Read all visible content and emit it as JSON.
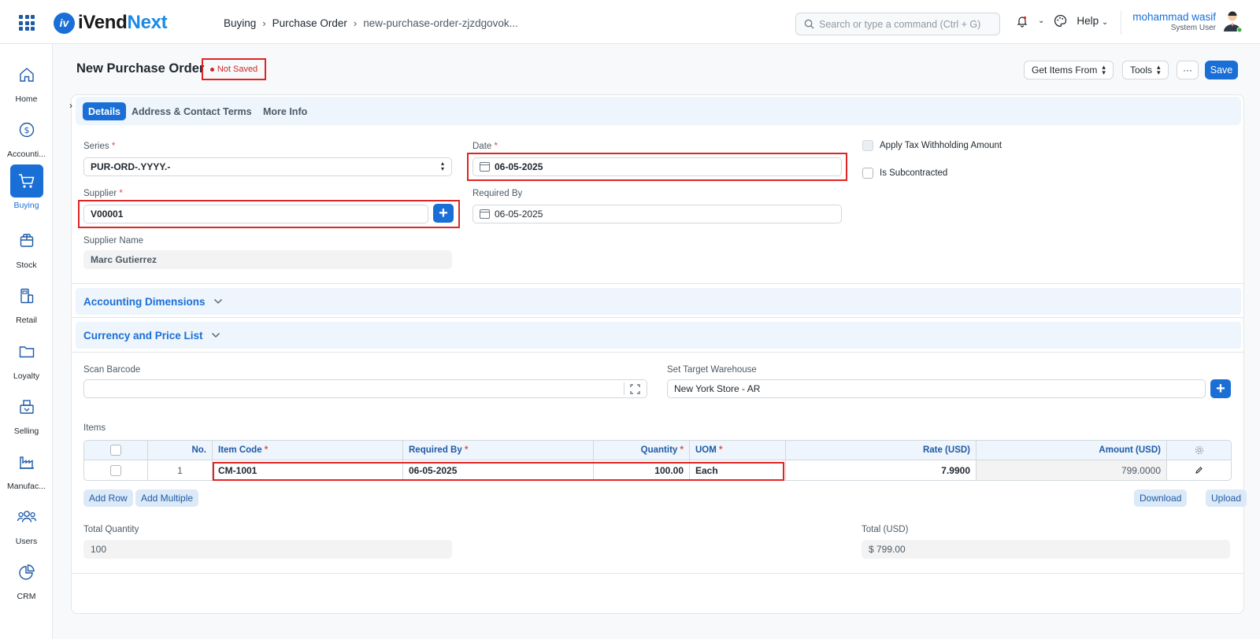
{
  "app": {
    "logo_prefix": "iVend",
    "logo_suffix": "Next"
  },
  "breadcrumb": [
    "Buying",
    "Purchase Order",
    "new-purchase-order-zjzdgovok..."
  ],
  "search": {
    "placeholder": "Search or type a command (Ctrl + G)"
  },
  "help_label": "Help",
  "user": {
    "name": "mohammad wasif",
    "role": "System User"
  },
  "sidebar": {
    "items": [
      {
        "label": "Home",
        "icon": "home-icon"
      },
      {
        "label": "Accounti...",
        "icon": "dollar-icon"
      },
      {
        "label": "Buying",
        "icon": "cart-icon",
        "active": true
      },
      {
        "label": "Stock",
        "icon": "box-icon"
      },
      {
        "label": "Retail",
        "icon": "pos-icon"
      },
      {
        "label": "Loyalty",
        "icon": "folder-icon"
      },
      {
        "label": "Selling",
        "icon": "selling-icon"
      },
      {
        "label": "Manufac...",
        "icon": "factory-icon"
      },
      {
        "label": "Users",
        "icon": "users-icon"
      },
      {
        "label": "CRM",
        "icon": "pie-chart-icon"
      }
    ]
  },
  "page": {
    "title": "New Purchase Order",
    "status": "Not Saved",
    "get_items_label": "Get Items From",
    "tools_label": "Tools",
    "more_label": "···",
    "save_label": "Save"
  },
  "tabs": [
    "Details",
    "Address & Contact",
    "Terms",
    "More Info"
  ],
  "form": {
    "series_label": "Series",
    "series_value": "PUR-ORD-.YYYY.-",
    "date_label": "Date",
    "date_value": "06-05-2025",
    "supplier_label": "Supplier",
    "supplier_value": "V00001",
    "required_by_label": "Required By",
    "required_by_value": "06-05-2025",
    "supplier_name_label": "Supplier Name",
    "supplier_name_value": "Marc Gutierrez",
    "apply_tax_label": "Apply Tax Withholding Amount",
    "is_subcontracted_label": "Is Subcontracted"
  },
  "sections": {
    "accounting_dimensions": "Accounting Dimensions",
    "currency_price_list": "Currency and Price List"
  },
  "barcode": {
    "label": "Scan Barcode",
    "value": ""
  },
  "warehouse": {
    "label": "Set Target Warehouse",
    "value": "New York Store - AR"
  },
  "items": {
    "label": "Items",
    "columns": {
      "no": "No.",
      "item_code": "Item Code",
      "required_by": "Required By",
      "quantity": "Quantity",
      "uom": "UOM",
      "rate": "Rate (USD)",
      "amount": "Amount (USD)"
    },
    "rows": [
      {
        "no": "1",
        "item_code": "CM-1001",
        "required_by": "06-05-2025",
        "quantity": "100.00",
        "uom": "Each",
        "rate": "7.9900",
        "amount": "799.0000"
      }
    ],
    "add_row_label": "Add Row",
    "add_multiple_label": "Add Multiple",
    "download_label": "Download",
    "upload_label": "Upload"
  },
  "totals": {
    "total_quantity_label": "Total Quantity",
    "total_quantity_value": "100",
    "total_label": "Total (USD)",
    "total_value": "$ 799.00"
  }
}
